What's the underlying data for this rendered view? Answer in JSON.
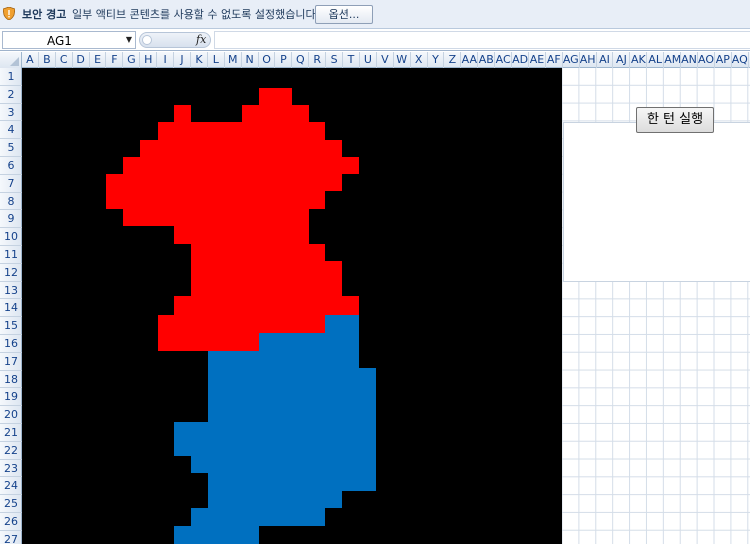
{
  "security_bar": {
    "title": "보안 경고",
    "message": "일부 액티브 콘텐츠를 사용할 수 없도록 설정했습니다.",
    "options_button": "옵션...",
    "icon": "shield-warning-icon"
  },
  "formula_bar": {
    "name_box": "AG1",
    "fx_label": "fx",
    "formula": ""
  },
  "columns": [
    "A",
    "B",
    "C",
    "D",
    "E",
    "F",
    "G",
    "H",
    "I",
    "J",
    "K",
    "L",
    "M",
    "N",
    "O",
    "P",
    "Q",
    "R",
    "S",
    "T",
    "U",
    "V",
    "W",
    "X",
    "Y",
    "Z",
    "AA",
    "AB",
    "AC",
    "AD",
    "AE",
    "AF",
    "AG",
    "AH",
    "AI",
    "AJ",
    "AK",
    "AL",
    "AM",
    "AN",
    "AO",
    "AP",
    "AQ"
  ],
  "rows": [
    "1",
    "2",
    "3",
    "4",
    "5",
    "6",
    "7",
    "8",
    "9",
    "10",
    "11",
    "12",
    "13",
    "14",
    "15",
    "16",
    "17",
    "18",
    "19",
    "20",
    "21",
    "22",
    "23",
    "24",
    "25",
    "26",
    "27"
  ],
  "run_button": "한 턴 실행",
  "colors": {
    "north": "#ff0000",
    "south": "#0070c0",
    "background": "#000000"
  }
}
